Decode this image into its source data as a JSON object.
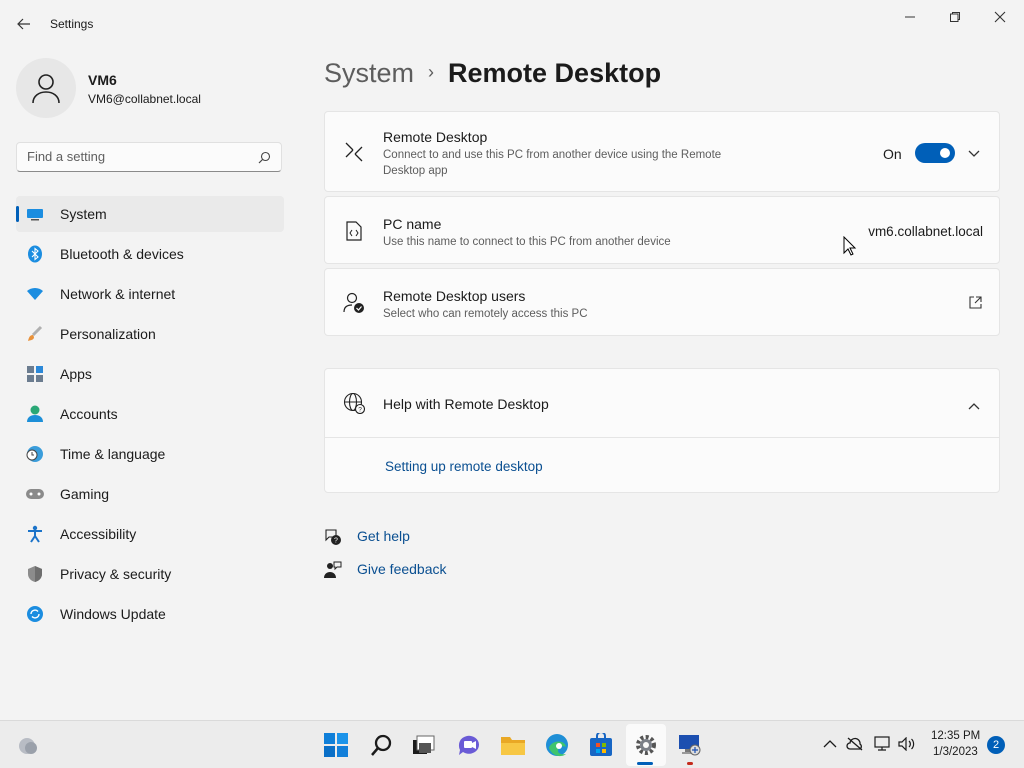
{
  "window": {
    "title": "Settings",
    "controls": [
      "minimize",
      "maximize",
      "close"
    ]
  },
  "profile": {
    "name": "VM6",
    "email": "VM6@collabnet.local"
  },
  "search": {
    "placeholder": "Find a setting"
  },
  "sidebar": {
    "items": [
      {
        "label": "System",
        "icon": "system-icon",
        "active": true
      },
      {
        "label": "Bluetooth & devices",
        "icon": "bluetooth-icon"
      },
      {
        "label": "Network & internet",
        "icon": "wifi-icon"
      },
      {
        "label": "Personalization",
        "icon": "brush-icon"
      },
      {
        "label": "Apps",
        "icon": "apps-icon"
      },
      {
        "label": "Accounts",
        "icon": "person-icon"
      },
      {
        "label": "Time & language",
        "icon": "globe-clock-icon"
      },
      {
        "label": "Gaming",
        "icon": "gamepad-icon"
      },
      {
        "label": "Accessibility",
        "icon": "accessibility-icon"
      },
      {
        "label": "Privacy & security",
        "icon": "shield-icon"
      },
      {
        "label": "Windows Update",
        "icon": "update-icon"
      }
    ]
  },
  "breadcrumb": {
    "parent": "System",
    "separator": "›",
    "current": "Remote Desktop"
  },
  "cards": {
    "remote_desktop": {
      "title": "Remote Desktop",
      "description": "Connect to and use this PC from another device using the Remote Desktop app",
      "toggle_label": "On",
      "toggle_on": true
    },
    "pc_name": {
      "title": "PC name",
      "description": "Use this name to connect to this PC from another device",
      "value": "vm6.collabnet.local"
    },
    "users": {
      "title": "Remote Desktop users",
      "description": "Select who can remotely access this PC"
    },
    "help": {
      "title": "Help with Remote Desktop",
      "link": "Setting up remote desktop"
    }
  },
  "footer": {
    "get_help": "Get help",
    "give_feedback": "Give feedback"
  },
  "taskbar": {
    "time": "12:35 PM",
    "date": "1/3/2023",
    "notifications": "2"
  },
  "colors": {
    "accent": "#005fb8",
    "link": "#0a4f91",
    "background": "#f3f3f3",
    "card": "#fbfbfb"
  }
}
